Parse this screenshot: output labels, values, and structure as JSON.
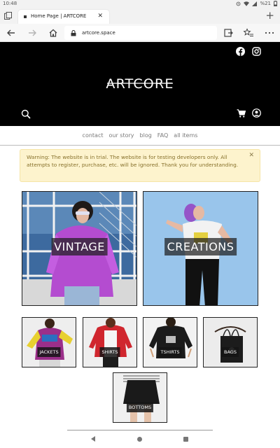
{
  "status_bar": {
    "time": "10:48",
    "battery": "%21"
  },
  "browser": {
    "tab_title": "Home Page | ARTCORE",
    "url": "artcore.space"
  },
  "site": {
    "logo": "ARTCORE",
    "nav": [
      "contact",
      "our story",
      "blog",
      "FAQ",
      "all items"
    ],
    "alert_text": "Warning: The website is in trial. The website is for testing developers only. All attempts to register, purchase, etc. will be ignored. Thank you for understanding.",
    "featured": [
      "VINTAGE",
      "CREATIONS"
    ],
    "categories": [
      "JACKETS",
      "SHIRTS",
      "TSHIRTS",
      "BAGS",
      "BOTTOMS"
    ]
  },
  "colors": {
    "header_bg": "#000000",
    "alert_bg": "#fdf3cd",
    "alert_text": "#86702a"
  },
  "icons": {
    "header": [
      "facebook-icon",
      "instagram-icon",
      "search-icon",
      "cart-icon",
      "account-icon"
    ],
    "browser": [
      "back-arrow-icon",
      "forward-arrow-icon",
      "home-icon",
      "lock-icon",
      "share-icon",
      "favorites-icon",
      "more-icon"
    ]
  }
}
